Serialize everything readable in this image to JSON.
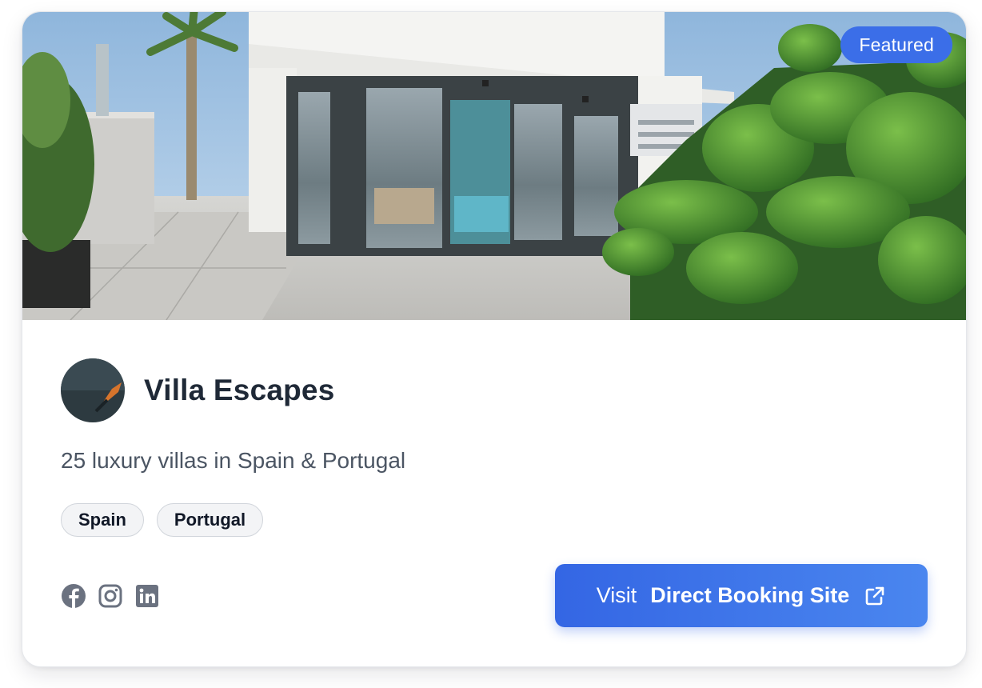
{
  "listing": {
    "badge": "Featured",
    "name": "Villa Escapes",
    "description": "25 luxury villas in Spain & Portugal",
    "tags": [
      "Spain",
      "Portugal"
    ],
    "social_icons": [
      "facebook-icon",
      "instagram-icon",
      "linkedin-icon"
    ],
    "cta": {
      "prefix": "Visit",
      "label": "Direct Booking Site",
      "icon": "external-link-icon"
    }
  },
  "colors": {
    "accent": "#3b6ee8",
    "title": "#1f2937",
    "muted": "#4b5563",
    "icon": "#6b7280"
  }
}
